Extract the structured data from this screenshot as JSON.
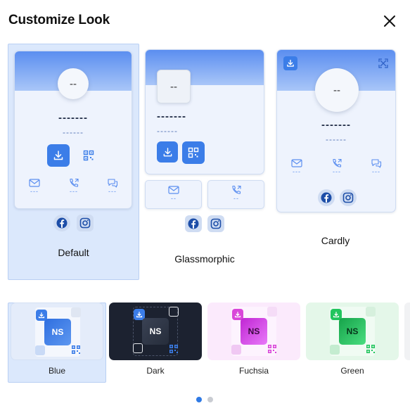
{
  "header": {
    "title": "Customize Look"
  },
  "layouts": [
    {
      "name": "Default",
      "avatar": "--",
      "name_placeholder": "-------",
      "sub_placeholder": "------",
      "contacts": [
        {
          "icon": "mail-icon",
          "value": "---"
        },
        {
          "icon": "phone-icon",
          "value": "---"
        },
        {
          "icon": "chat-icon",
          "value": "---"
        }
      ],
      "socials": [
        "facebook-icon",
        "instagram-icon"
      ],
      "selected": true
    },
    {
      "name": "Glassmorphic",
      "avatar": "--",
      "name_placeholder": "-------",
      "sub_placeholder": "------",
      "contacts": [
        {
          "icon": "mail-icon",
          "value": "--"
        },
        {
          "icon": "phone-icon",
          "value": "--"
        }
      ],
      "socials": [
        "facebook-icon",
        "instagram-icon"
      ],
      "selected": false
    },
    {
      "name": "Cardly",
      "avatar": "--",
      "name_placeholder": "-------",
      "sub_placeholder": "------",
      "contacts": [
        {
          "icon": "mail-icon",
          "value": "---"
        },
        {
          "icon": "phone-icon",
          "value": "---"
        },
        {
          "icon": "chat-icon",
          "value": "---"
        }
      ],
      "socials": [
        "facebook-icon",
        "instagram-icon"
      ],
      "selected": false
    }
  ],
  "themes": [
    {
      "name": "Blue",
      "initials": "NS",
      "accent": "#3b7de8",
      "selected": true
    },
    {
      "name": "Dark",
      "initials": "NS",
      "accent": "#1c2230",
      "selected": false
    },
    {
      "name": "Fuchsia",
      "initials": "NS",
      "accent": "#d946d9",
      "selected": false
    },
    {
      "name": "Green",
      "initials": "NS",
      "accent": "#22c55e",
      "selected": false
    }
  ],
  "pagination": {
    "pages": 2,
    "current": 1
  },
  "colors": {
    "primary": "#3b7de8",
    "selected_bg": "#dbe8fc"
  }
}
